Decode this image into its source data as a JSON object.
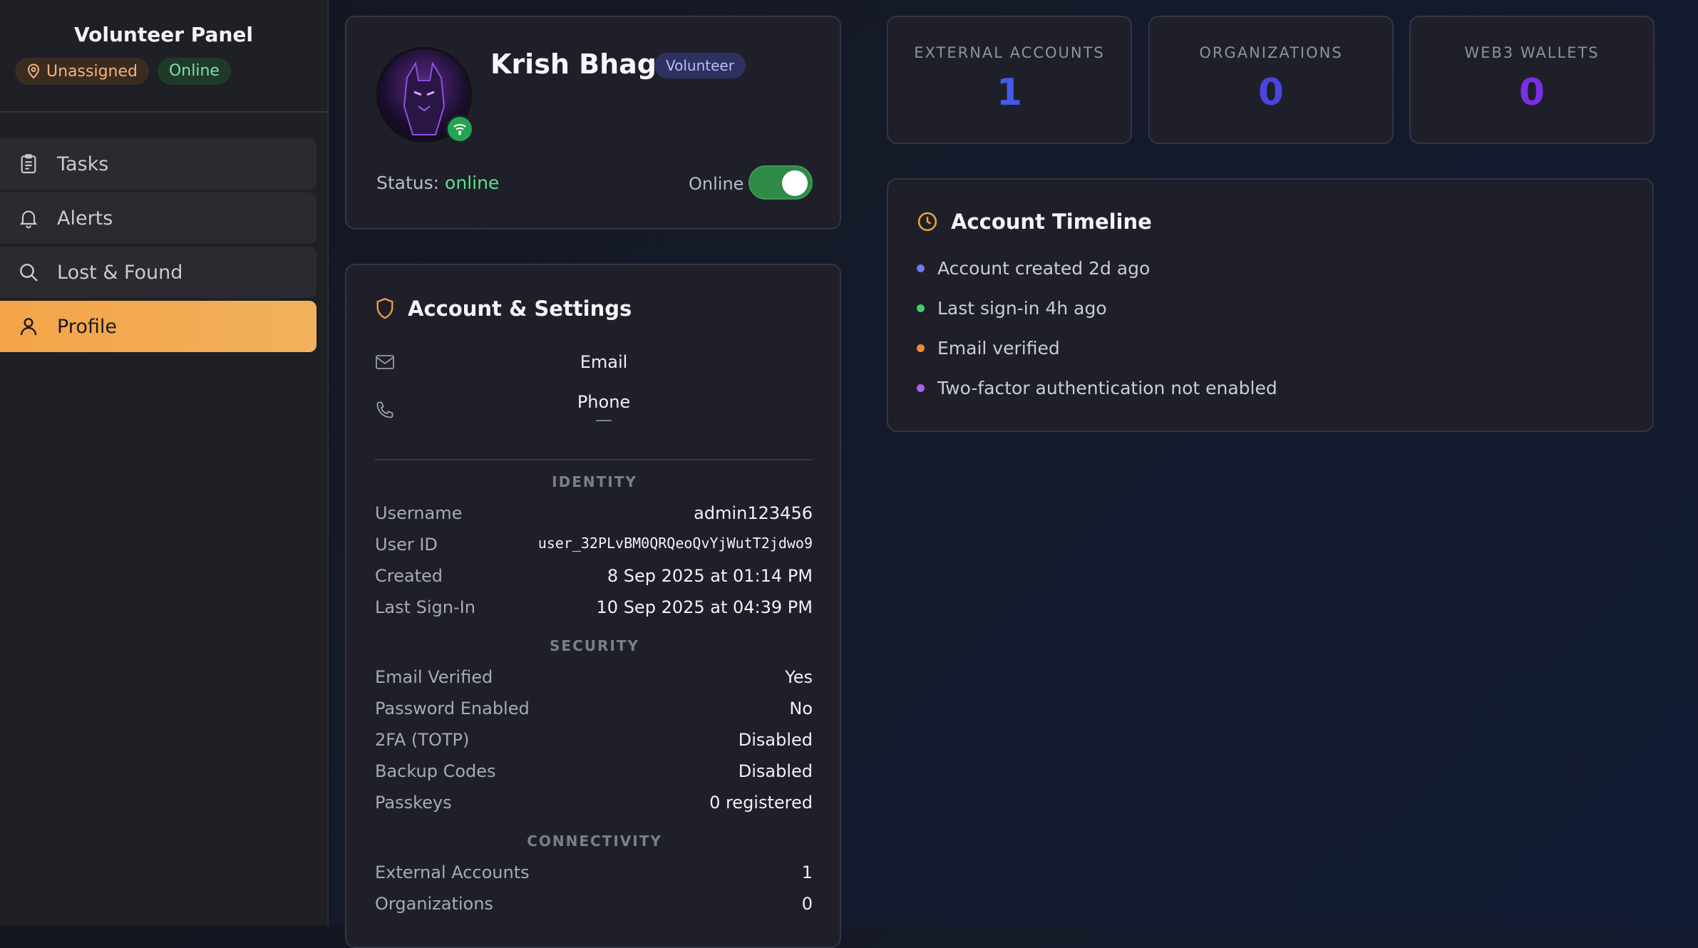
{
  "sidebar": {
    "title": "Volunteer Panel",
    "location_badge": "Unassigned",
    "status_badge": "Online",
    "items": [
      {
        "label": "Tasks",
        "icon": "clipboard-icon"
      },
      {
        "label": "Alerts",
        "icon": "bell-icon"
      },
      {
        "label": "Lost & Found",
        "icon": "search-icon"
      },
      {
        "label": "Profile",
        "icon": "user-icon",
        "active": true
      }
    ]
  },
  "profile": {
    "name": "Krish Bhagat",
    "role": "Volunteer",
    "status_label": "Status:",
    "status_value": "online",
    "toggle_label": "Online",
    "toggle_on": true
  },
  "settings": {
    "title": "Account & Settings",
    "email_label": "Email",
    "phone_label": "Phone",
    "phone_value": "—",
    "identity_header": "IDENTITY",
    "identity": [
      {
        "key": "Username",
        "value": "admin123456"
      },
      {
        "key": "User ID",
        "value": "user_32PLvBM0QRQeoQvYjWutT2jdwo9"
      },
      {
        "key": "Created",
        "value": "8 Sep 2025 at 01:14 PM"
      },
      {
        "key": "Last Sign-In",
        "value": "10 Sep 2025 at 04:39 PM"
      }
    ],
    "security_header": "SECURITY",
    "security": [
      {
        "key": "Email Verified",
        "value": "Yes"
      },
      {
        "key": "Password Enabled",
        "value": "No"
      },
      {
        "key": "2FA (TOTP)",
        "value": "Disabled"
      },
      {
        "key": "Backup Codes",
        "value": "Disabled"
      },
      {
        "key": "Passkeys",
        "value": "0 registered"
      }
    ],
    "connectivity_header": "CONNECTIVITY",
    "connectivity": [
      {
        "key": "External Accounts",
        "value": "1"
      },
      {
        "key": "Organizations",
        "value": "0"
      }
    ]
  },
  "stats": [
    {
      "label": "EXTERNAL ACCOUNTS",
      "value": "1",
      "color": "#3f5be8"
    },
    {
      "label": "ORGANIZATIONS",
      "value": "0",
      "color": "#4a44e0"
    },
    {
      "label": "WEB3 WALLETS",
      "value": "0",
      "color": "#7a2fe6"
    }
  ],
  "timeline": {
    "title": "Account Timeline",
    "items": [
      {
        "text": "Account created 2d ago",
        "color": "#6f78f2"
      },
      {
        "text": "Last sign-in 4h ago",
        "color": "#3ecf6a"
      },
      {
        "text": "Email verified",
        "color": "#f08a2c"
      },
      {
        "text": "Two-factor authentication not enabled",
        "color": "#b05ff0"
      }
    ]
  },
  "colors": {
    "accent": "#f4a448",
    "online_green": "#5fe08a"
  }
}
